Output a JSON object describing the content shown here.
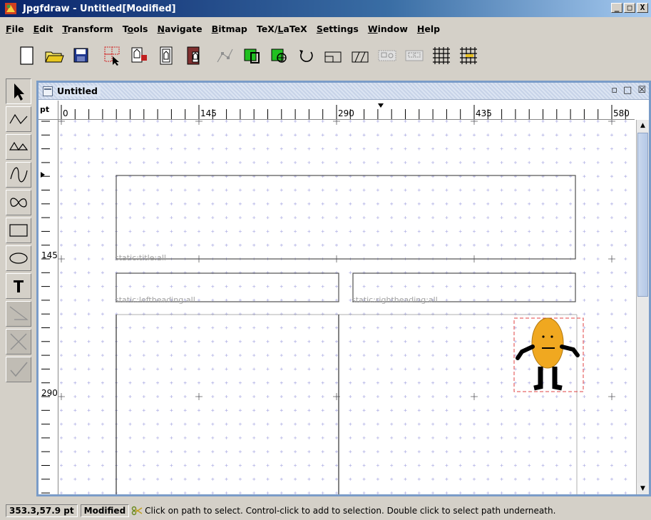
{
  "window": {
    "title": "Jpgfdraw - Untitled[Modified]",
    "minimize": "_",
    "maximize": "□",
    "close": "X"
  },
  "menubar": {
    "items": [
      {
        "label": "File",
        "mnemonic_index": 0
      },
      {
        "label": "Edit",
        "mnemonic_index": 0
      },
      {
        "label": "Transform",
        "mnemonic_index": 0
      },
      {
        "label": "Tools",
        "mnemonic_index": 1
      },
      {
        "label": "Navigate",
        "mnemonic_index": 0
      },
      {
        "label": "Bitmap",
        "mnemonic_index": 0
      },
      {
        "label": "TeX/LaTeX",
        "mnemonic_index": 4
      },
      {
        "label": "Settings",
        "mnemonic_index": 0
      },
      {
        "label": "Window",
        "mnemonic_index": 0
      },
      {
        "label": "Help",
        "mnemonic_index": 0
      }
    ]
  },
  "toolbar": {
    "buttons": [
      {
        "name": "new-button",
        "icon": "new-document-icon"
      },
      {
        "name": "open-button",
        "icon": "open-folder-icon"
      },
      {
        "name": "save-button",
        "icon": "save-disk-icon"
      },
      {
        "name": "select-all-button",
        "icon": "select-all-icon"
      },
      {
        "name": "move-to-front-button",
        "icon": "move-to-front-icon"
      },
      {
        "name": "move-to-back-button",
        "icon": "move-to-back-icon"
      },
      {
        "name": "edit-path-button",
        "icon": "edit-path-icon"
      },
      {
        "name": "edit-path-disabled-button",
        "icon": "edit-path-disabled-icon"
      },
      {
        "name": "reduce-to-grey-button",
        "icon": "line-colour-icon"
      },
      {
        "name": "fill-colour-button",
        "icon": "fill-colour-icon"
      },
      {
        "name": "rotate-button",
        "icon": "rotate-icon"
      },
      {
        "name": "scale-button",
        "icon": "scale-icon"
      },
      {
        "name": "shear-button",
        "icon": "shear-icon"
      },
      {
        "name": "group-button",
        "icon": "group-icon"
      },
      {
        "name": "ungroup-button",
        "icon": "ungroup-icon"
      },
      {
        "name": "show-grid-button",
        "icon": "grid-icon"
      },
      {
        "name": "lock-grid-button",
        "icon": "lock-grid-icon"
      }
    ]
  },
  "palette": {
    "tools": [
      {
        "name": "select-tool",
        "icon": "arrow-pointer-icon",
        "disabled": false
      },
      {
        "name": "open-line-tool",
        "icon": "open-line-path-icon",
        "disabled": false
      },
      {
        "name": "closed-line-tool",
        "icon": "closed-line-path-icon",
        "disabled": false
      },
      {
        "name": "open-curve-tool",
        "icon": "open-curve-path-icon",
        "disabled": false
      },
      {
        "name": "closed-curve-tool",
        "icon": "closed-curve-path-icon",
        "disabled": false
      },
      {
        "name": "rectangle-tool",
        "icon": "rectangle-icon",
        "disabled": false
      },
      {
        "name": "ellipse-tool",
        "icon": "ellipse-icon",
        "disabled": false
      },
      {
        "name": "text-tool",
        "icon": "text-t-icon",
        "disabled": false
      },
      {
        "name": "gap-tool",
        "icon": "gap-line-icon",
        "disabled": true
      },
      {
        "name": "abandon-tool",
        "icon": "abandon-x-icon",
        "disabled": true
      },
      {
        "name": "finish-tool",
        "icon": "finish-check-icon",
        "disabled": true
      }
    ]
  },
  "document": {
    "title": "Untitled",
    "ruler_unit": "pt",
    "hruler_labels": [
      "0",
      "145",
      "290",
      "435",
      "580"
    ],
    "vruler_labels": [
      "145",
      "290"
    ],
    "frames": [
      {
        "label": "static:title:all"
      },
      {
        "label": "static:leftheading:all"
      },
      {
        "label": "static:rightheading:all"
      }
    ]
  },
  "colors": {
    "grid": "#b4b4e6",
    "frame_border": "#505050",
    "selection": "#e04040",
    "figure_body": "#f0a820"
  },
  "statusbar": {
    "position": "353.3,57.9 pt",
    "modified": "Modified",
    "message": "Click on path to select. Control-click to add to selection. Double click to select path underneath."
  }
}
